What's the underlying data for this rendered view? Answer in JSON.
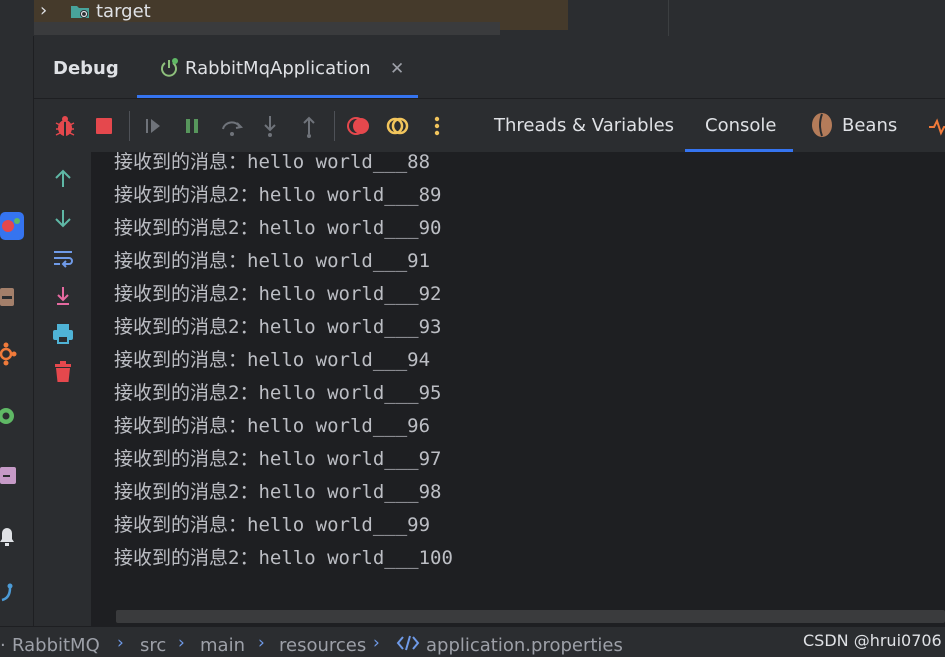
{
  "project_tree": {
    "row_label": "target"
  },
  "debug_panel": {
    "title": "Debug",
    "run_tab_label": "RabbitMqApplication"
  },
  "toolbar": {
    "tabs": [
      {
        "label": "Threads & Variables"
      },
      {
        "label": "Console"
      },
      {
        "label": "Beans"
      }
    ]
  },
  "console": {
    "lines": [
      "接收到的消息：hello world___88",
      "接收到的消息2：hello world___89",
      "接收到的消息2：hello world___90",
      "接收到的消息：hello world___91",
      "接收到的消息2：hello world___92",
      "接收到的消息2：hello world___93",
      "接收到的消息：hello world___94",
      "接收到的消息2：hello world___95",
      "接收到的消息：hello world___96",
      "接收到的消息2：hello world___97",
      "接收到的消息2：hello world___98",
      "接收到的消息：hello world___99",
      "接收到的消息2：hello world___100"
    ]
  },
  "breadcrumb": {
    "items": [
      "RabbitMQ",
      "src",
      "main",
      "resources",
      "application.properties"
    ]
  },
  "watermark": "CSDN @hrui0706",
  "colors": {
    "accent": "#3574f0",
    "stop_red": "#e5484d",
    "resume_green": "#57965c",
    "console_bg": "#1e1f22",
    "panel_bg": "#2b2d30"
  }
}
